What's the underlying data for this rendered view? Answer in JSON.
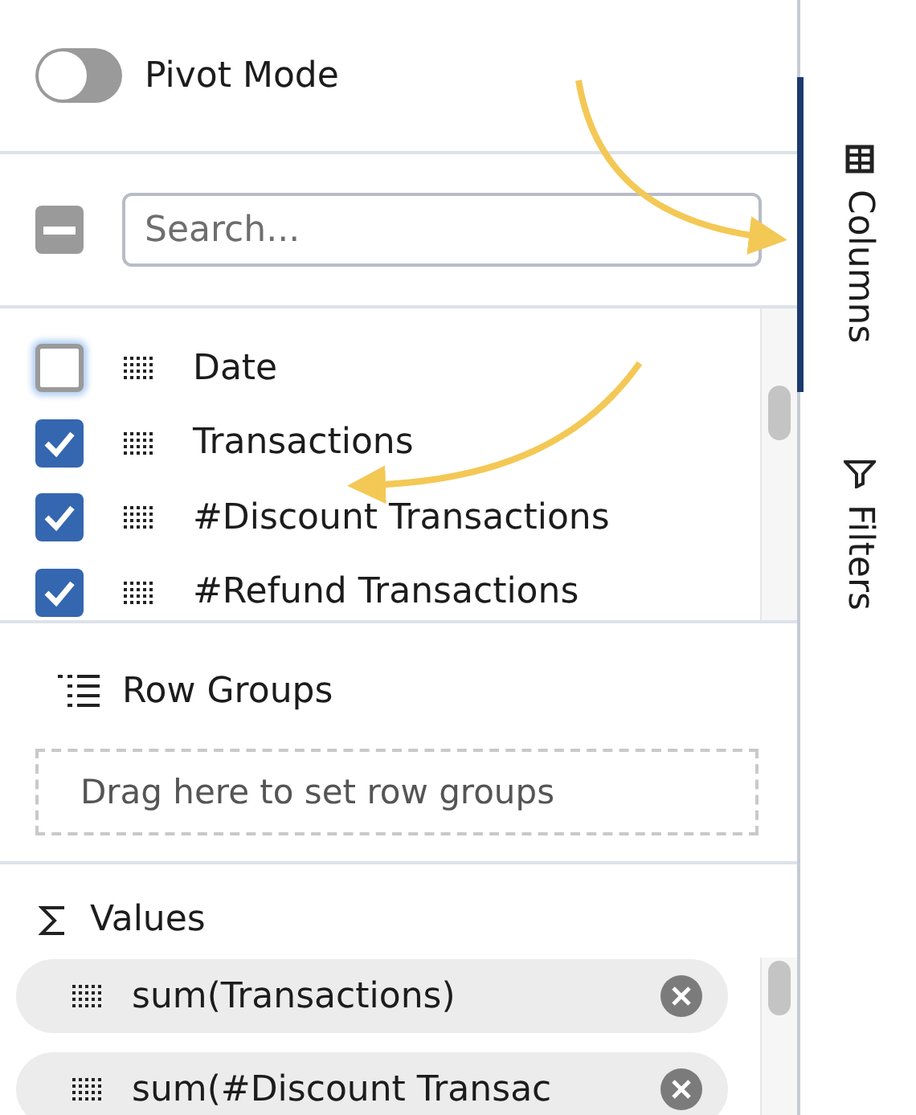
{
  "pivot_mode": {
    "label": "Pivot Mode",
    "on": false
  },
  "select_all": {
    "indeterminate": true
  },
  "search": {
    "placeholder": "Search..."
  },
  "columns": [
    {
      "label": "Date",
      "checked": false
    },
    {
      "label": "Transactions",
      "checked": true
    },
    {
      "label": "#Discount Transactions",
      "checked": true
    },
    {
      "label": "#Refund Transactions",
      "checked": true
    }
  ],
  "row_groups": {
    "title": "Row Groups",
    "placeholder": "Drag here to set row groups"
  },
  "values": {
    "title": "Values",
    "items": [
      {
        "label": "sum(Transactions)"
      },
      {
        "label": "sum(#Discount Transac"
      }
    ]
  },
  "side_tabs": [
    {
      "kind": "columns",
      "label": "Columns",
      "selected": true
    },
    {
      "kind": "filters",
      "label": "Filters",
      "selected": false
    }
  ]
}
